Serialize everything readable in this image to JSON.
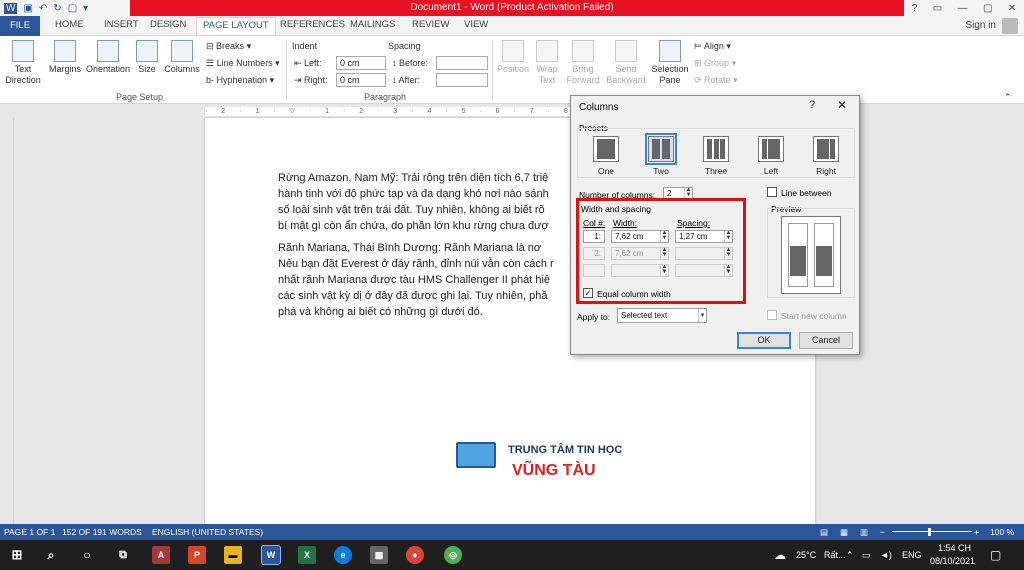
{
  "window": {
    "title": "Document1 - Word (Product Activation Failed)",
    "signin": "Sign in"
  },
  "tabs": [
    "FILE",
    "HOME",
    "INSERT",
    "DESIGN",
    "PAGE LAYOUT",
    "REFERENCES",
    "MAILINGS",
    "REVIEW",
    "VIEW"
  ],
  "ribbon": {
    "text_direction": "Text Direction",
    "margins": "Margins",
    "orientation": "Orientation",
    "size": "Size",
    "columns": "Columns",
    "breaks": "Breaks",
    "line_numbers": "Line Numbers",
    "hyphenation": "Hyphenation",
    "page_setup": "Page Setup",
    "indent": "Indent",
    "left": "Left:",
    "right": "Right:",
    "left_value": "0 cm",
    "right_value": "0 cm",
    "spacing": "Spacing",
    "before": "Before:",
    "after": "After:",
    "paragraph": "Paragraph",
    "position": "Position",
    "wrap_text": "Wrap Text",
    "bring_forward": "Bring Forward",
    "send_backward": "Send Backward",
    "selection_pane": "Selection Pane",
    "align": "Align",
    "group": "Group",
    "rotate": "Rotate"
  },
  "document": {
    "p1": [
      "Rừng Amazon, Nam Mỹ: Trải rộng trên diện tích 6,7 triệ",
      "hành tinh với độ phức tạp và đa dạng khó nơi nào sánh",
      "số loài sinh vật trên trái đất. Tuy nhiên, không ai biết rõ",
      "bí mật gì còn ẩn chứa, do phần lớn khu rừng chưa đượ"
    ],
    "p2": [
      "Rãnh Mariana, Thái Bình Dương: Rãnh Mariana là nơ",
      "Nếu bạn đặt Everest ở đáy rãnh, đỉnh núi vẫn còn cách r",
      "nhất rãnh Mariana được tàu HMS Challenger II phát hiệ",
      "các sinh vật kỳ dị ở đây đã được ghi lại. Tuy nhiên, phầ",
      "phá và không ai biết có những gì dưới đó."
    ]
  },
  "logo": {
    "line1": "TRUNG TÂM TIN HỌC",
    "line2": "VŨNG TÀU"
  },
  "dialog": {
    "title": "Columns",
    "help": "?",
    "close": "✕",
    "presets_label": "Presets",
    "presets": [
      "One",
      "Two",
      "Three",
      "Left",
      "Right"
    ],
    "num_columns_label": "Number of columns:",
    "num_columns": "2",
    "line_between": "Line between",
    "width_spacing_label": "Width and spacing",
    "col_header": "Col #:",
    "width_header": "Width:",
    "spacing_header": "Spacing:",
    "row1": {
      "col": "1:",
      "width": "7,62 cm",
      "spacing": "1,27 cm"
    },
    "row2": {
      "col": "2:",
      "width": "7,62 cm",
      "spacing": ""
    },
    "equal_width": "Equal column width",
    "preview_label": "Preview",
    "apply_to_label": "Apply to:",
    "apply_to": "Selected text",
    "start_new_column": "Start new column",
    "ok": "OK",
    "cancel": "Cancel"
  },
  "status": {
    "page": "PAGE 1 OF 1",
    "words": "152 OF 191 WORDS",
    "language": "ENGLISH (UNITED STATES)",
    "zoom": "100 %"
  },
  "taskbar": {
    "weather": "25°C",
    "weather_desc": "Rất...",
    "lang": "ENG",
    "time": "1:54 CH",
    "date": "08/10/2021"
  }
}
